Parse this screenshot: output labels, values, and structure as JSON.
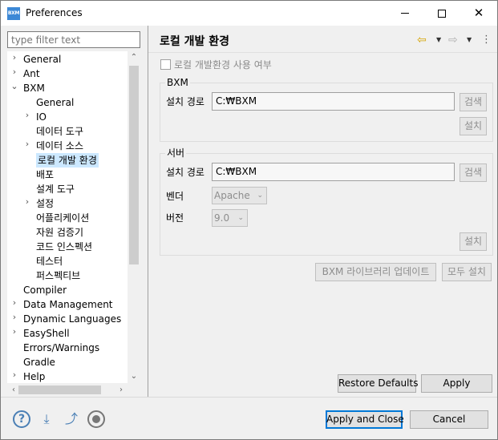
{
  "window": {
    "icon_text": "BXM",
    "title": "Preferences"
  },
  "filter": {
    "placeholder": "type filter text"
  },
  "tree": {
    "items": [
      {
        "label": "General",
        "twisty": "›"
      },
      {
        "label": "Ant",
        "twisty": "›"
      },
      {
        "label": "BXM",
        "twisty": "⌄"
      },
      {
        "label": "General",
        "twisty": ""
      },
      {
        "label": "IO",
        "twisty": "›"
      },
      {
        "label": "데이터 도구",
        "twisty": ""
      },
      {
        "label": "데이터 소스",
        "twisty": "›"
      },
      {
        "label": "로컬 개발 환경",
        "twisty": "",
        "selected": true
      },
      {
        "label": "배포",
        "twisty": ""
      },
      {
        "label": "설계 도구",
        "twisty": ""
      },
      {
        "label": "설정",
        "twisty": "›"
      },
      {
        "label": "어플리케이션",
        "twisty": ""
      },
      {
        "label": "자원 검증기",
        "twisty": ""
      },
      {
        "label": "코드 인스펙션",
        "twisty": ""
      },
      {
        "label": "테스터",
        "twisty": ""
      },
      {
        "label": "퍼스펙티브",
        "twisty": ""
      },
      {
        "label": "Compiler",
        "twisty": ""
      },
      {
        "label": "Data Management",
        "twisty": "›"
      },
      {
        "label": "Dynamic Languages",
        "twisty": "›"
      },
      {
        "label": "EasyShell",
        "twisty": "›"
      },
      {
        "label": "Errors/Warnings",
        "twisty": ""
      },
      {
        "label": "Gradle",
        "twisty": ""
      },
      {
        "label": "Help",
        "twisty": "›"
      }
    ]
  },
  "page": {
    "title": "로컬 개발 환경",
    "use_local_label": "로컬 개발환경 사용 여부",
    "bxm_group": {
      "legend": "BXM",
      "path_label": "설치 경로",
      "path_value": "C:₩BXM",
      "search_label": "검색",
      "install_label": "설치"
    },
    "server_group": {
      "legend": "서버",
      "path_label": "설치 경로",
      "path_value": "C:₩BXM",
      "search_label": "검색",
      "vendor_label": "벤더",
      "vendor_value": "Apache",
      "version_label": "버전",
      "version_value": "9.0",
      "install_label": "설치"
    },
    "library_update_label": "BXM 라이브러리 업데이트",
    "install_all_label": "모두 설치",
    "restore_defaults_label": "Restore Defaults",
    "apply_label": "Apply"
  },
  "footer": {
    "apply_close_label": "Apply and Close",
    "cancel_label": "Cancel"
  }
}
